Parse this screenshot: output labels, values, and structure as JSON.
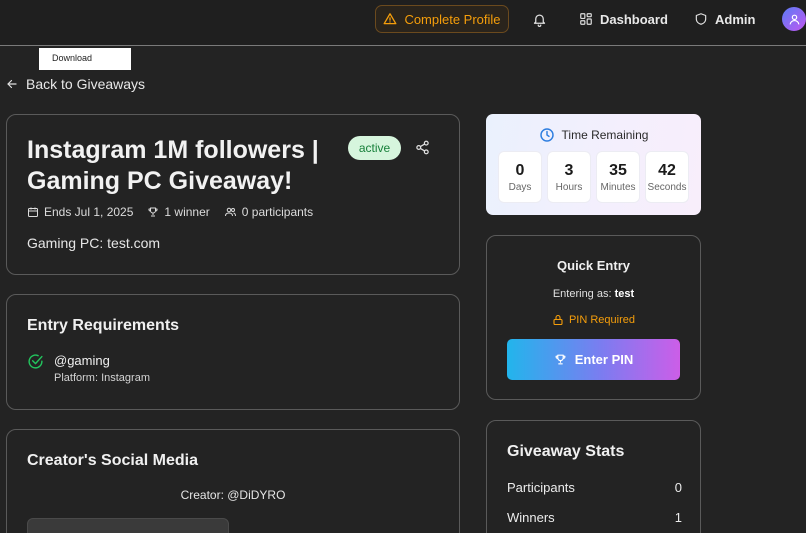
{
  "header": {
    "complete_profile": "Complete Profile",
    "dashboard": "Dashboard",
    "admin": "Admin"
  },
  "tooltip": {
    "download": "Download"
  },
  "back_link": "Back to Giveaways",
  "giveaway": {
    "title": "Instagram 1M followers | Gaming PC Giveaway!",
    "status": "active",
    "ends": "Ends Jul 1, 2025",
    "winners": "1 winner",
    "participants": "0 participants",
    "prize": "Gaming PC: test.com"
  },
  "requirements": {
    "heading": "Entry Requirements",
    "items": [
      {
        "handle": "@gaming",
        "platform": "Platform: Instagram"
      }
    ]
  },
  "creator_social": {
    "heading": "Creator's Social Media",
    "creator": "Creator: @DiDYRO"
  },
  "time_remaining": {
    "heading": "Time Remaining",
    "units": [
      {
        "value": "0",
        "label": "Days"
      },
      {
        "value": "3",
        "label": "Hours"
      },
      {
        "value": "35",
        "label": "Minutes"
      },
      {
        "value": "42",
        "label": "Seconds"
      }
    ]
  },
  "quick_entry": {
    "heading": "Quick Entry",
    "entering_label": "Entering as:",
    "username": "test",
    "pin_required": "PIN Required",
    "enter_pin": "Enter PIN"
  },
  "stats": {
    "heading": "Giveaway Stats",
    "rows": [
      {
        "label": "Participants",
        "value": "0"
      },
      {
        "label": "Winners",
        "value": "1"
      }
    ]
  },
  "colors": {
    "accent_orange": "#f59e0b",
    "active_badge_bg": "#d6f5dd",
    "active_badge_text": "#17803a",
    "gradient_start": "#22b5ec",
    "gradient_end": "#cc5ee8"
  }
}
